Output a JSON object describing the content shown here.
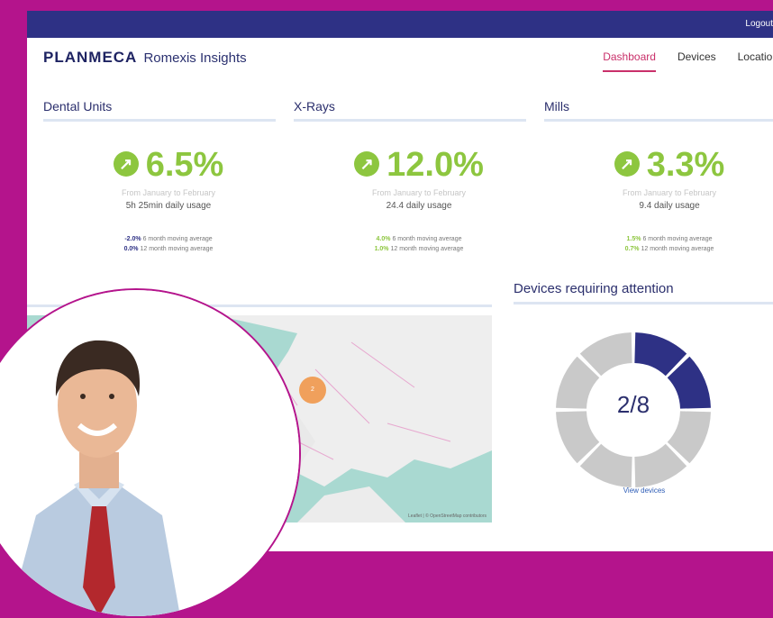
{
  "topbar": {
    "logout_label": "Logout"
  },
  "brand": {
    "name": "PLANMECA",
    "product": "Romexis Insights"
  },
  "nav": {
    "items": [
      "Dashboard",
      "Devices",
      "Locations"
    ],
    "active": "Dashboard"
  },
  "stats": [
    {
      "title": "Dental Units",
      "value": "6.5%",
      "range": "From January to February",
      "usage": "5h 25min daily usage",
      "avg6_value": "-2.0%",
      "avg6_label": "6 month moving average",
      "avg12_value": "0.0%",
      "avg12_label": "12 month moving average"
    },
    {
      "title": "X-Rays",
      "value": "12.0%",
      "range": "From January to February",
      "usage": "24.4 daily usage",
      "avg6_value": "4.0%",
      "avg6_label": "6 month moving average",
      "avg12_value": "1.0%",
      "avg12_label": "12 month moving average"
    },
    {
      "title": "Mills",
      "value": "3.3%",
      "range": "From January to February",
      "usage": "9.4 daily usage",
      "avg6_value": "1.5%",
      "avg6_label": "6 month moving average",
      "avg12_value": "0.7%",
      "avg12_label": "12 month moving average"
    }
  ],
  "map": {
    "cluster_count": "2",
    "attribution": "Leaflet | © OpenStreetMap contributors"
  },
  "devices": {
    "title": "Devices requiring attention",
    "ratio": "2/8",
    "attention": 2,
    "total": 8,
    "view_label": "View devices",
    "colors": {
      "attention": "#2e3185",
      "ok": "#c9c9c9"
    }
  }
}
